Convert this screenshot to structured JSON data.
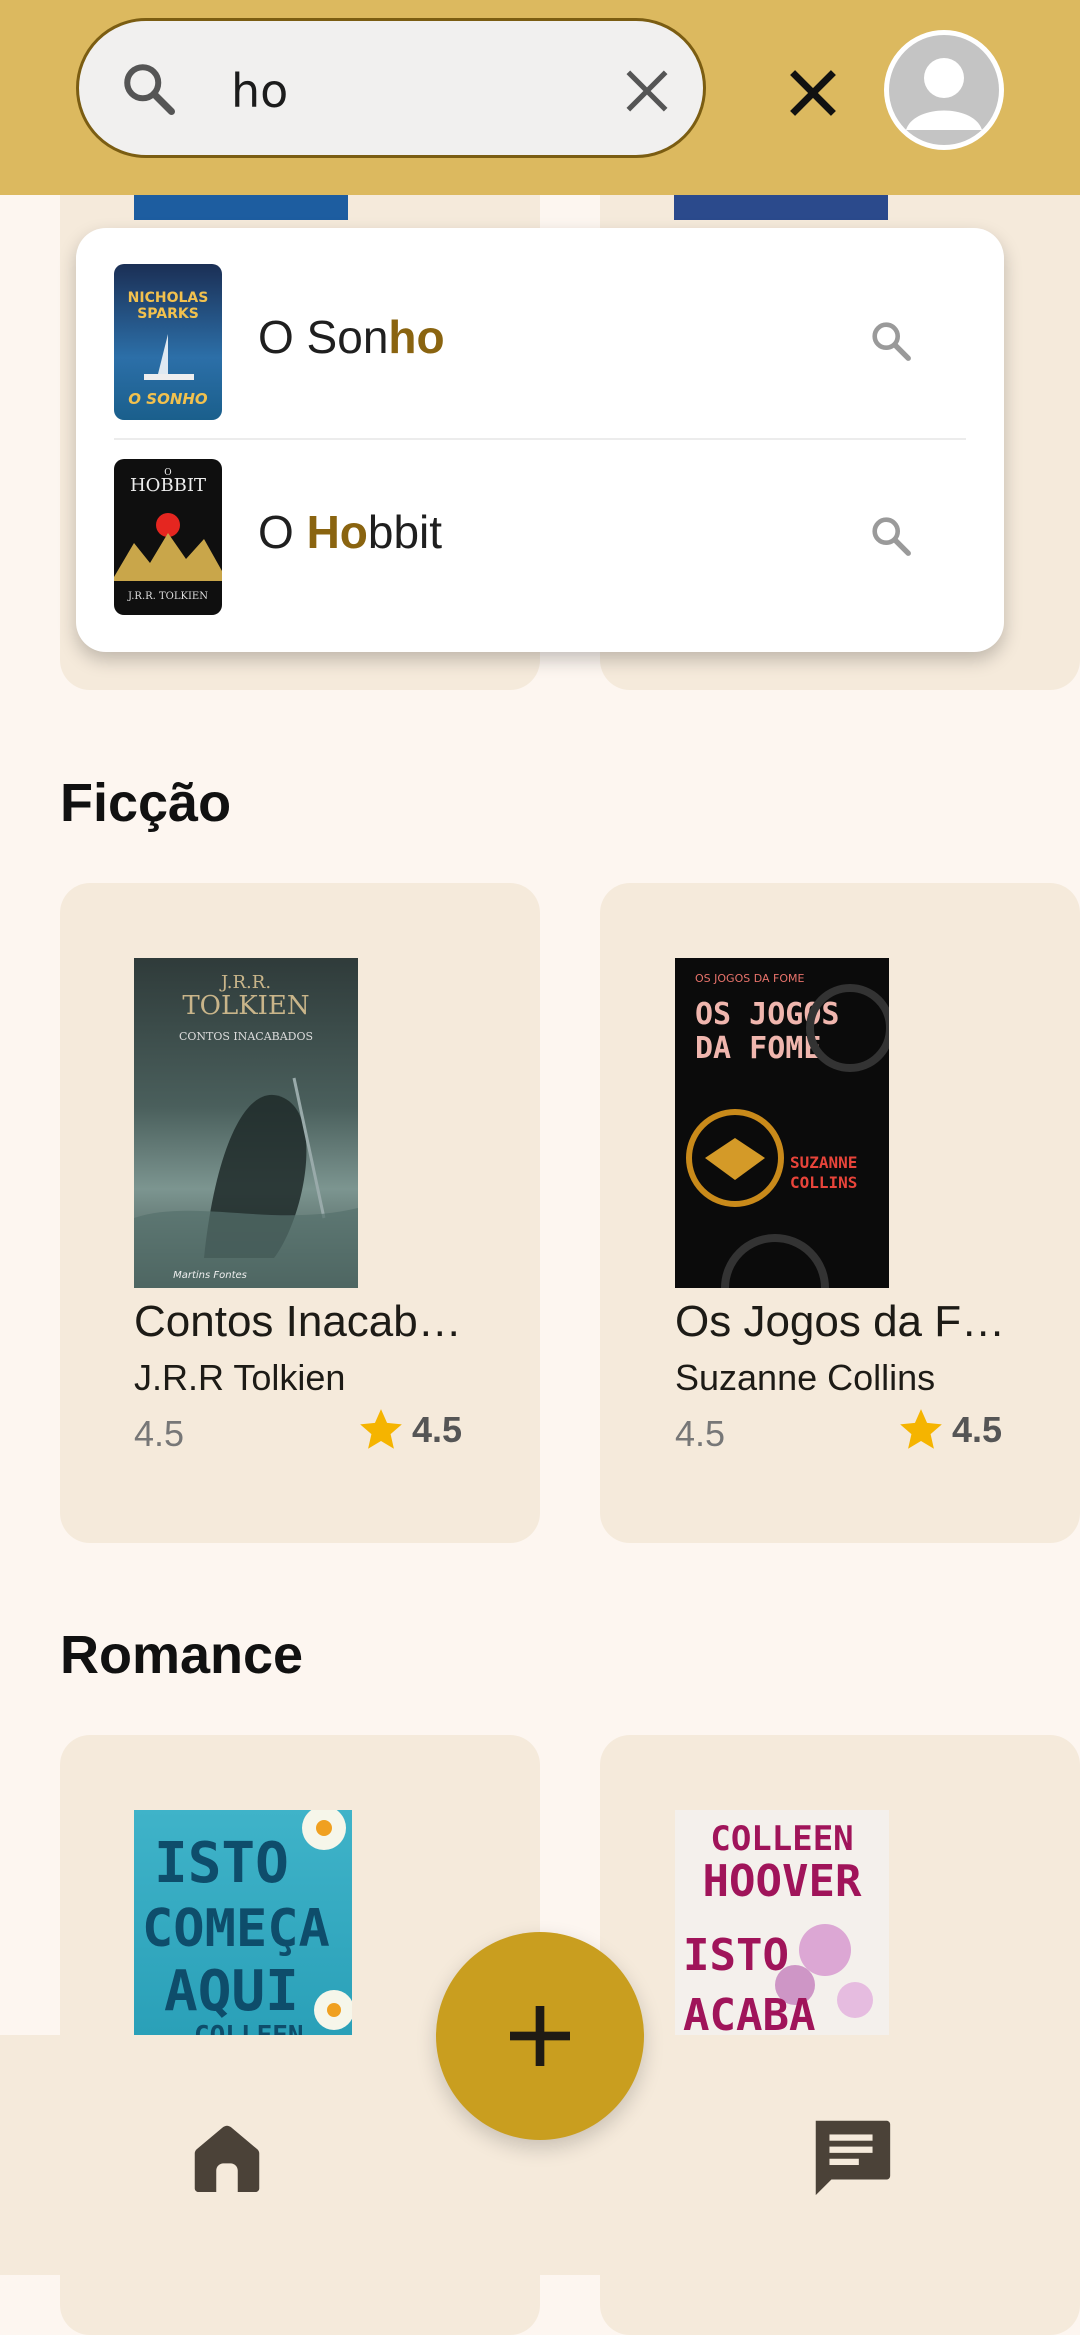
{
  "search": {
    "value": "ho",
    "placeholder": ""
  },
  "suggestions": [
    {
      "prefix": "O Son",
      "match": "ho",
      "suffix": "",
      "cover_text": [
        "NICHOLAS",
        "SPARKS",
        "O SONHO"
      ]
    },
    {
      "prefix": "O ",
      "match": "Ho",
      "suffix": "bbit",
      "cover_text": [
        "O",
        "HOBBIT",
        "J.R.R. TOLKIEN"
      ]
    }
  ],
  "sections": {
    "fiction": {
      "title": "Ficção",
      "books": [
        {
          "title": "Contos Inacab…",
          "author": "J.R.R Tolkien",
          "rating": "4.5",
          "stars": "4.5",
          "cover_text": [
            "J.R.R.",
            "TOLKIEN",
            "CONTOS INACABADOS",
            "Martins Fontes"
          ]
        },
        {
          "title": "Os Jogos da F…",
          "author": "Suzanne Collins",
          "rating": "4.5",
          "stars": "4.5",
          "cover_text": [
            "OS JOGOS DA FOME",
            "OS JOGOS",
            "DA FOME",
            "SUZANNE",
            "COLLINS"
          ]
        }
      ]
    },
    "romance": {
      "title": "Romance",
      "books": [
        {
          "cover_text": [
            "ISTO",
            "COMEÇA",
            "AQUI",
            "COLLEEN"
          ]
        },
        {
          "cover_text": [
            "COLLEEN",
            "HOOVER",
            "ISTO",
            "ACABA"
          ]
        }
      ]
    }
  },
  "colors": {
    "accent": "#dcb95f",
    "highlight": "#8a6410",
    "fab": "#c99e1f",
    "card": "#f5eadb",
    "star": "#f5b400"
  },
  "icons": {
    "search": "search-icon",
    "clear": "clear-icon",
    "close": "close-icon",
    "avatar": "avatar-icon",
    "home": "home-icon",
    "chat": "chat-icon",
    "add": "add-icon"
  }
}
